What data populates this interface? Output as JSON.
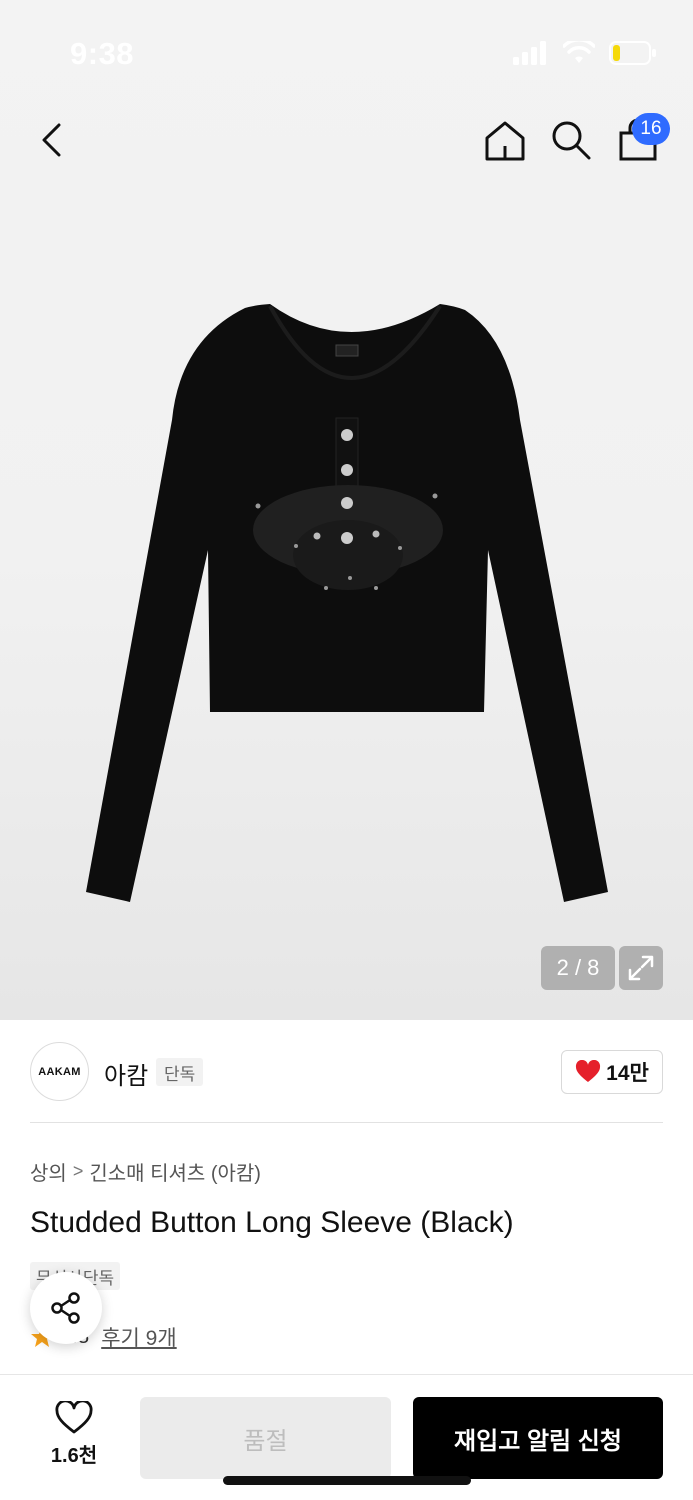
{
  "status_bar": {
    "time": "9:38"
  },
  "nav": {
    "cart_count": "16"
  },
  "gallery": {
    "counter": "2 / 8"
  },
  "brand": {
    "logo_text": "AAKAM",
    "name": "아캄",
    "tag": "단독",
    "likes": "14만"
  },
  "breadcrumb": {
    "category": "상의",
    "separator": ">",
    "subcategory": "긴소매 티셔츠 (아캄)"
  },
  "product": {
    "title": "Studded Button Long Sleeve (Black)",
    "exclusive_tag": "무신사단독",
    "rating": "4.8",
    "reviews": "후기 9개"
  },
  "bottom": {
    "wishlist_count": "1.6천",
    "soldout_label": "품절",
    "restock_label": "재입고 알림 신청"
  },
  "colors": {
    "accent_blue": "#2f6bff",
    "heart_red": "#e5202b",
    "star_orange": "#f7a21b"
  },
  "icons": [
    "back-arrow-icon",
    "home-icon",
    "search-icon",
    "shopping-bag-icon",
    "expand-icon",
    "heart-icon",
    "star-icon",
    "share-icon",
    "wifi-icon",
    "signal-icon",
    "battery-icon"
  ]
}
